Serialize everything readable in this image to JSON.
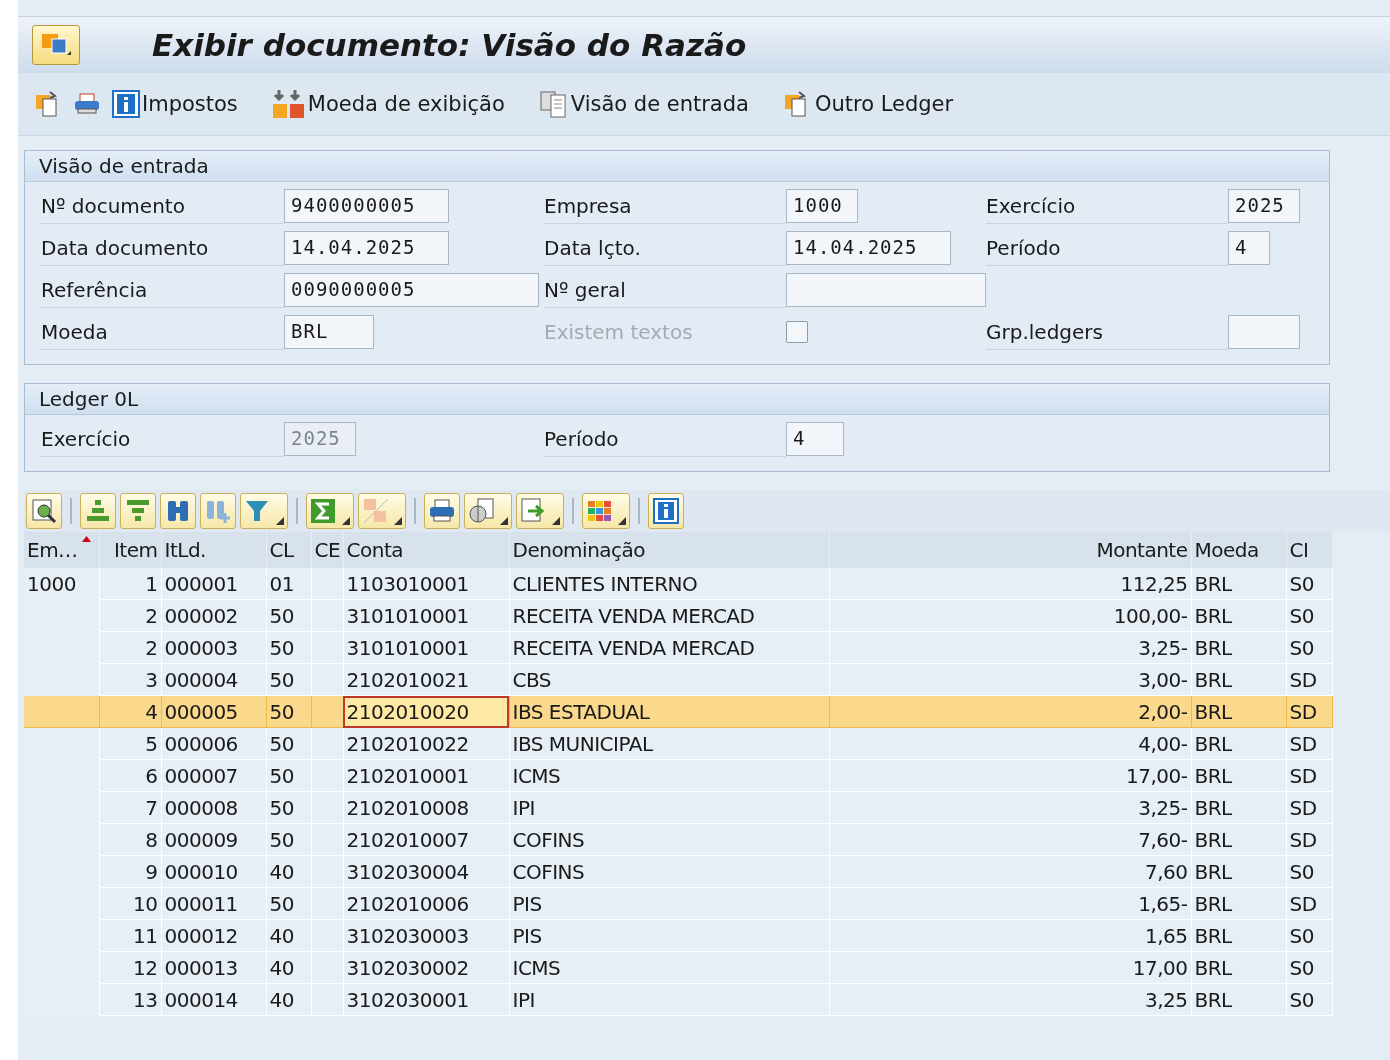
{
  "window": {
    "title": "Exibir documento: Visão do Razão"
  },
  "toolbar": [
    {
      "kind": "info",
      "label": "Impostos"
    },
    {
      "kind": "currency",
      "label": "Moeda de exibição"
    },
    {
      "kind": "view",
      "label": "Visão de entrada"
    },
    {
      "kind": "ledger",
      "label": "Outro Ledger"
    }
  ],
  "header": {
    "title": "Visão de entrada",
    "rows": [
      [
        {
          "kind": "field",
          "label": "Nº documento",
          "value": "9400000005"
        },
        {
          "kind": "field",
          "label": "Empresa",
          "value": "1000"
        },
        {
          "kind": "field",
          "label": "Exercício",
          "value": "2025"
        }
      ],
      [
        {
          "kind": "field",
          "label": "Data documento",
          "value": "14.04.2025"
        },
        {
          "kind": "field",
          "label": "Data lçto.",
          "value": "14.04.2025"
        },
        {
          "kind": "field",
          "label": "Período",
          "value": "4"
        }
      ],
      [
        {
          "kind": "field",
          "label": "Referência",
          "value": "0090000005"
        },
        {
          "kind": "field",
          "label": "Nº geral"
        }
      ],
      [
        {
          "kind": "field",
          "label": "Moeda",
          "value": "BRL"
        },
        {
          "kind": "checkbox",
          "label": "Existem textos",
          "checked": false,
          "disabled": true
        },
        {
          "kind": "field",
          "label": "Grp.ledgers"
        }
      ]
    ]
  },
  "ledger": {
    "title": "Ledger 0L",
    "rows": [
      [
        {
          "kind": "field",
          "label": "Exercício",
          "value": "2025",
          "disabled": true
        },
        {
          "kind": "field",
          "label": "Período",
          "value": "4"
        }
      ]
    ]
  },
  "table": {
    "columns": [
      {
        "label": "Em…",
        "kind": "text",
        "sorted": true
      },
      {
        "label": "Item",
        "kind": "number",
        "sorted": false
      },
      {
        "label": "ItLd.",
        "kind": "text",
        "sorted": false
      },
      {
        "label": "CL",
        "kind": "text",
        "sorted": false
      },
      {
        "label": "CE",
        "kind": "text",
        "sorted": false
      },
      {
        "label": "Conta",
        "kind": "text",
        "sorted": false
      },
      {
        "label": "Denominação",
        "kind": "text",
        "sorted": false
      },
      {
        "label": "Montante",
        "kind": "number",
        "sorted": false
      },
      {
        "label": "Moeda",
        "kind": "text",
        "sorted": false
      },
      {
        "label": "CI",
        "kind": "text",
        "sorted": false
      }
    ],
    "rows": [
      {
        "selected": false,
        "focused": false,
        "cells": [
          "1000",
          "1",
          "000001",
          "01",
          "",
          "1103010001",
          "CLIENTES INTERNO",
          "112,25",
          "BRL",
          "S0"
        ]
      },
      {
        "selected": false,
        "focused": false,
        "cells": [
          "",
          "2",
          "000002",
          "50",
          "",
          "3101010001",
          "RECEITA VENDA MERCAD",
          "100,00-",
          "BRL",
          "S0"
        ]
      },
      {
        "selected": false,
        "focused": false,
        "cells": [
          "",
          "2",
          "000003",
          "50",
          "",
          "3101010001",
          "RECEITA VENDA MERCAD",
          "3,25-",
          "BRL",
          "S0"
        ]
      },
      {
        "selected": false,
        "focused": false,
        "cells": [
          "",
          "3",
          "000004",
          "50",
          "",
          "2102010021",
          "CBS",
          "3,00-",
          "BRL",
          "SD"
        ]
      },
      {
        "selected": true,
        "focused": true,
        "cells": [
          "",
          "4",
          "000005",
          "50",
          "",
          "2102010020",
          "IBS ESTADUAL",
          "2,00-",
          "BRL",
          "SD"
        ]
      },
      {
        "selected": false,
        "focused": false,
        "cells": [
          "",
          "5",
          "000006",
          "50",
          "",
          "2102010022",
          "IBS MUNICIPAL",
          "4,00-",
          "BRL",
          "SD"
        ]
      },
      {
        "selected": false,
        "focused": false,
        "cells": [
          "",
          "6",
          "000007",
          "50",
          "",
          "2102010001",
          "ICMS",
          "17,00-",
          "BRL",
          "SD"
        ]
      },
      {
        "selected": false,
        "focused": false,
        "cells": [
          "",
          "7",
          "000008",
          "50",
          "",
          "2102010008",
          "IPI",
          "3,25-",
          "BRL",
          "SD"
        ]
      },
      {
        "selected": false,
        "focused": false,
        "cells": [
          "",
          "8",
          "000009",
          "50",
          "",
          "2102010007",
          "COFINS",
          "7,60-",
          "BRL",
          "SD"
        ]
      },
      {
        "selected": false,
        "focused": false,
        "cells": [
          "",
          "9",
          "000010",
          "40",
          "",
          "3102030004",
          "COFINS",
          "7,60",
          "BRL",
          "S0"
        ]
      },
      {
        "selected": false,
        "focused": false,
        "cells": [
          "",
          "10",
          "000011",
          "50",
          "",
          "2102010006",
          "PIS",
          "1,65-",
          "BRL",
          "SD"
        ]
      },
      {
        "selected": false,
        "focused": false,
        "cells": [
          "",
          "11",
          "000012",
          "40",
          "",
          "3102030003",
          "PIS",
          "1,65",
          "BRL",
          "S0"
        ]
      },
      {
        "selected": false,
        "focused": false,
        "cells": [
          "",
          "12",
          "000013",
          "40",
          "",
          "3102030002",
          "ICMS",
          "17,00",
          "BRL",
          "S0"
        ]
      },
      {
        "selected": false,
        "focused": false,
        "cells": [
          "",
          "13",
          "000014",
          "40",
          "",
          "3102030001",
          "IPI",
          "3,25",
          "BRL",
          "S0"
        ]
      }
    ]
  }
}
